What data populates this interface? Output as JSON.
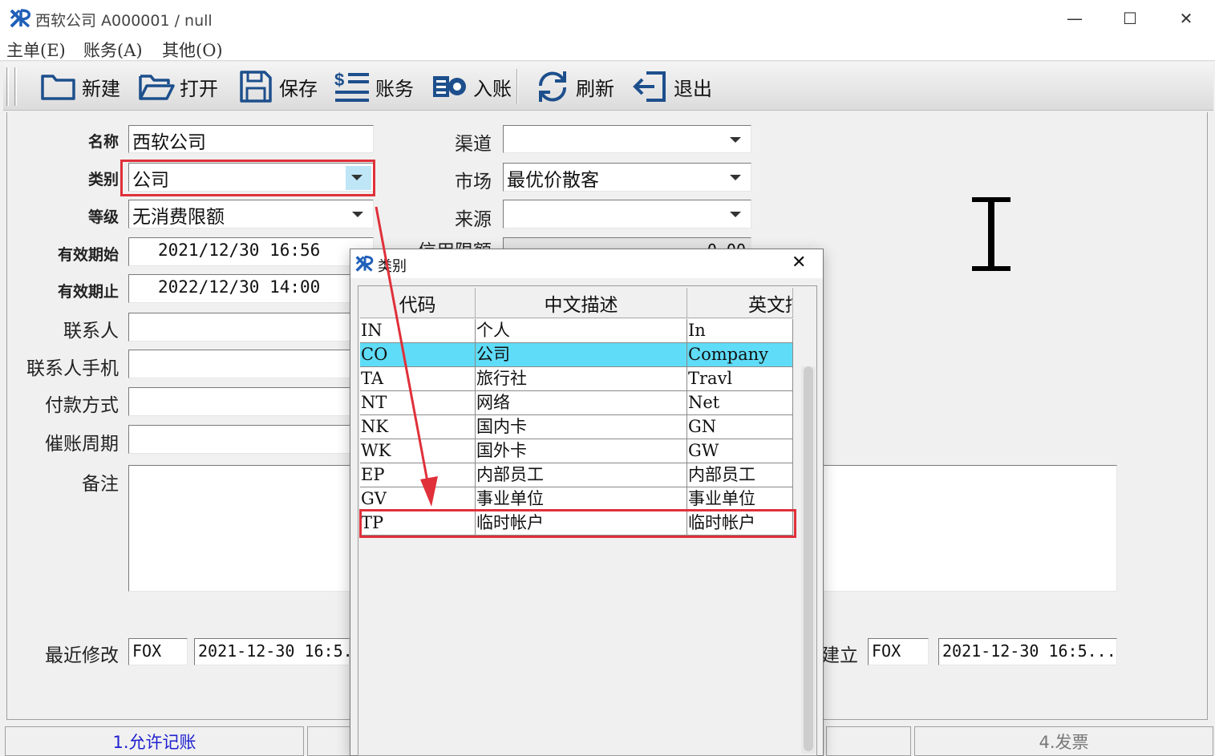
{
  "window": {
    "title": "西软公司  A000001  /  null",
    "controls": {
      "minimize": "—",
      "maximize": "☐",
      "close": "✕"
    }
  },
  "menu": {
    "items": [
      "主单(E)",
      "账务(A)",
      "其他(O)"
    ]
  },
  "toolbar": {
    "buttons": [
      {
        "label": "新建",
        "icon": "folder-new-icon"
      },
      {
        "label": "打开",
        "icon": "folder-open-icon"
      },
      {
        "label": "保存",
        "icon": "save-icon"
      },
      {
        "label": "账务",
        "icon": "ledger-icon"
      },
      {
        "label": "入账",
        "icon": "post-entry-icon"
      },
      {
        "label": "刷新",
        "icon": "refresh-icon"
      },
      {
        "label": "退出",
        "icon": "exit-icon"
      }
    ]
  },
  "form": {
    "name": {
      "label": "名称",
      "value": "西软公司"
    },
    "category": {
      "label": "类别",
      "value": "公司"
    },
    "level": {
      "label": "等级",
      "value": "无消费限额"
    },
    "valid_from": {
      "label": "有效期始",
      "value": "2021/12/30 16:56"
    },
    "valid_to": {
      "label": "有效期止",
      "value": "2022/12/30 14:00"
    },
    "contact": {
      "label": "联系人",
      "value": ""
    },
    "contact_phone": {
      "label": "联系人手机",
      "value": ""
    },
    "payment": {
      "label": "付款方式",
      "value": ""
    },
    "dunning": {
      "label": "催账周期",
      "value": ""
    },
    "remark": {
      "label": "备注",
      "value": ""
    },
    "channel": {
      "label": "渠道",
      "value": ""
    },
    "market": {
      "label": "市场",
      "value": "最优价散客"
    },
    "source": {
      "label": "来源",
      "value": ""
    },
    "credit_limit": {
      "label": "信用限额",
      "value": "0.00"
    },
    "last_modified": {
      "label": "最近修改",
      "user": "FOX",
      "time": "2021-12-30 16:5..."
    },
    "created": {
      "label": "建立",
      "user": "FOX",
      "time": "2021-12-30 16:5..."
    }
  },
  "tabs": [
    "1.允许记账",
    "4.发票"
  ],
  "dialog": {
    "title": "类别",
    "columns": [
      "代码",
      "中文描述",
      "英文描述"
    ],
    "rows": [
      {
        "code": "IN",
        "cn": "个人",
        "en": "In"
      },
      {
        "code": "CO",
        "cn": "公司",
        "en": "Company",
        "selected": true
      },
      {
        "code": "TA",
        "cn": "旅行社",
        "en": "Travl"
      },
      {
        "code": "NT",
        "cn": "网络",
        "en": "Net"
      },
      {
        "code": "NK",
        "cn": "国内卡",
        "en": "GN"
      },
      {
        "code": "WK",
        "cn": "国外卡",
        "en": "GW"
      },
      {
        "code": "EP",
        "cn": "内部员工",
        "en": "内部员工"
      },
      {
        "code": "GV",
        "cn": "事业单位",
        "en": "事业单位"
      },
      {
        "code": "TP",
        "cn": "临时帐户",
        "en": "临时帐户",
        "highlighted": true
      }
    ],
    "close": "✕"
  },
  "colors": {
    "selected_row": "#5fdcf7",
    "annotation": "#e0303a"
  }
}
